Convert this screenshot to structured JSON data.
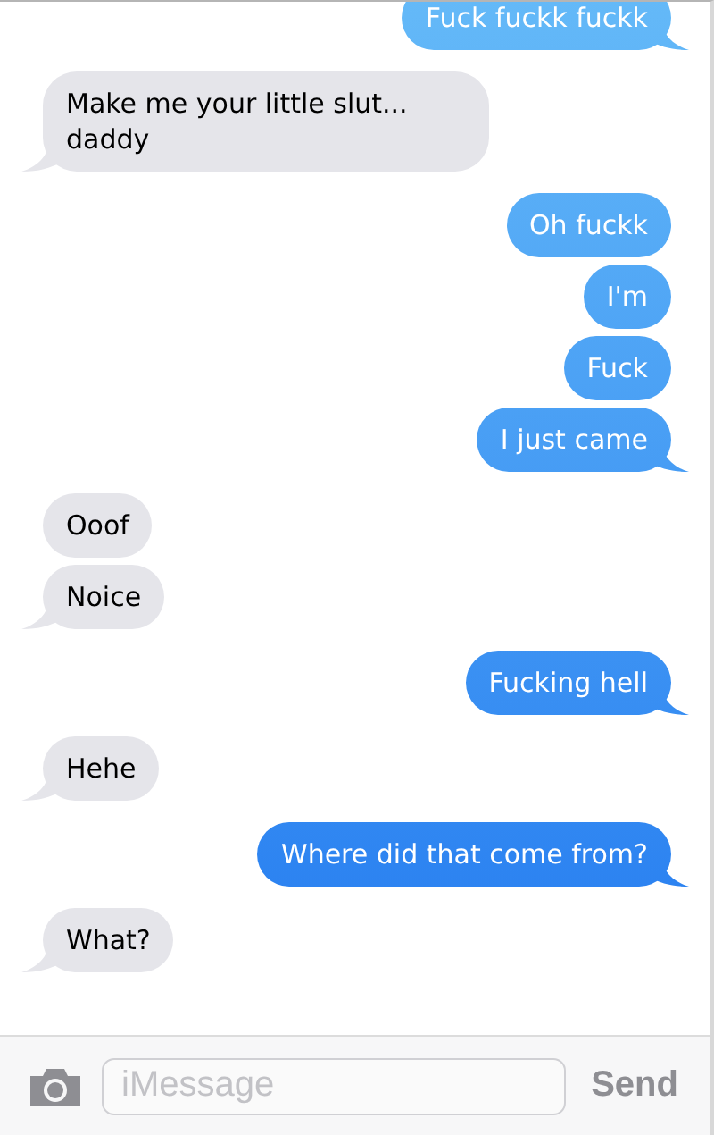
{
  "messages": [
    {
      "kind": "sent",
      "text": "Fuck fuckk fuckk",
      "tail": true
    },
    {
      "kind": "received",
      "text": "Make me your little slut... daddy",
      "tail": true
    },
    {
      "kind": "sent",
      "text": "Oh fuckk",
      "tail": false
    },
    {
      "kind": "sent",
      "text": "I'm",
      "tail": false
    },
    {
      "kind": "sent",
      "text": "Fuck",
      "tail": false
    },
    {
      "kind": "sent",
      "text": "I just came",
      "tail": true
    },
    {
      "kind": "received",
      "text": "Ooof",
      "tail": false
    },
    {
      "kind": "received",
      "text": "Noice",
      "tail": true
    },
    {
      "kind": "sent",
      "text": "Fucking hell",
      "tail": true
    },
    {
      "kind": "received",
      "text": "Hehe",
      "tail": true
    },
    {
      "kind": "sent",
      "text": "Where did that come from?",
      "tail": true
    },
    {
      "kind": "received",
      "text": "What?",
      "tail": true
    }
  ],
  "composer": {
    "placeholder": "iMessage",
    "send": "Send"
  }
}
